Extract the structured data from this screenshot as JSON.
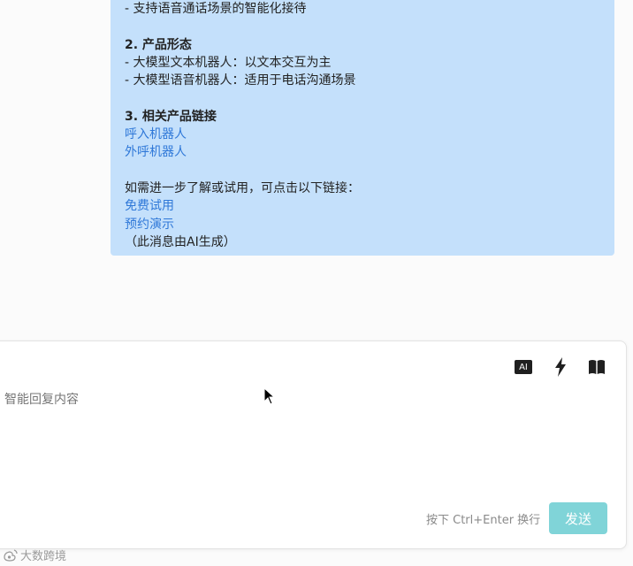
{
  "message": {
    "line_1": "- 支持语音通话场景的智能化接待",
    "section_2_title": "2. 产品形态",
    "line_2": "- 大模型文本机器人：以文本交互为主",
    "line_3": "- 大模型语音机器人：适用于电话沟通场景",
    "section_3_title": "3. 相关产品链接",
    "link_1": "呼入机器人",
    "link_2": "外呼机器人",
    "line_4": "如需进一步了解或试用，可点击以下链接：",
    "link_3": "免费试用",
    "link_4": "预约演示",
    "footer": "（此消息由AI生成）"
  },
  "composer": {
    "placeholder": "智能回复内容",
    "ai_button_label": "AI",
    "hint": "按下 Ctrl+Enter 换行",
    "send_label": "发送"
  },
  "icons": {
    "ai": "ai-icon",
    "bolt": "lightning-icon",
    "book": "book-icon"
  },
  "watermark": "大数跨境",
  "colors": {
    "bubble_bg": "#c4e0fb",
    "link": "#2f78d8",
    "send_button": "#80d4d8"
  }
}
